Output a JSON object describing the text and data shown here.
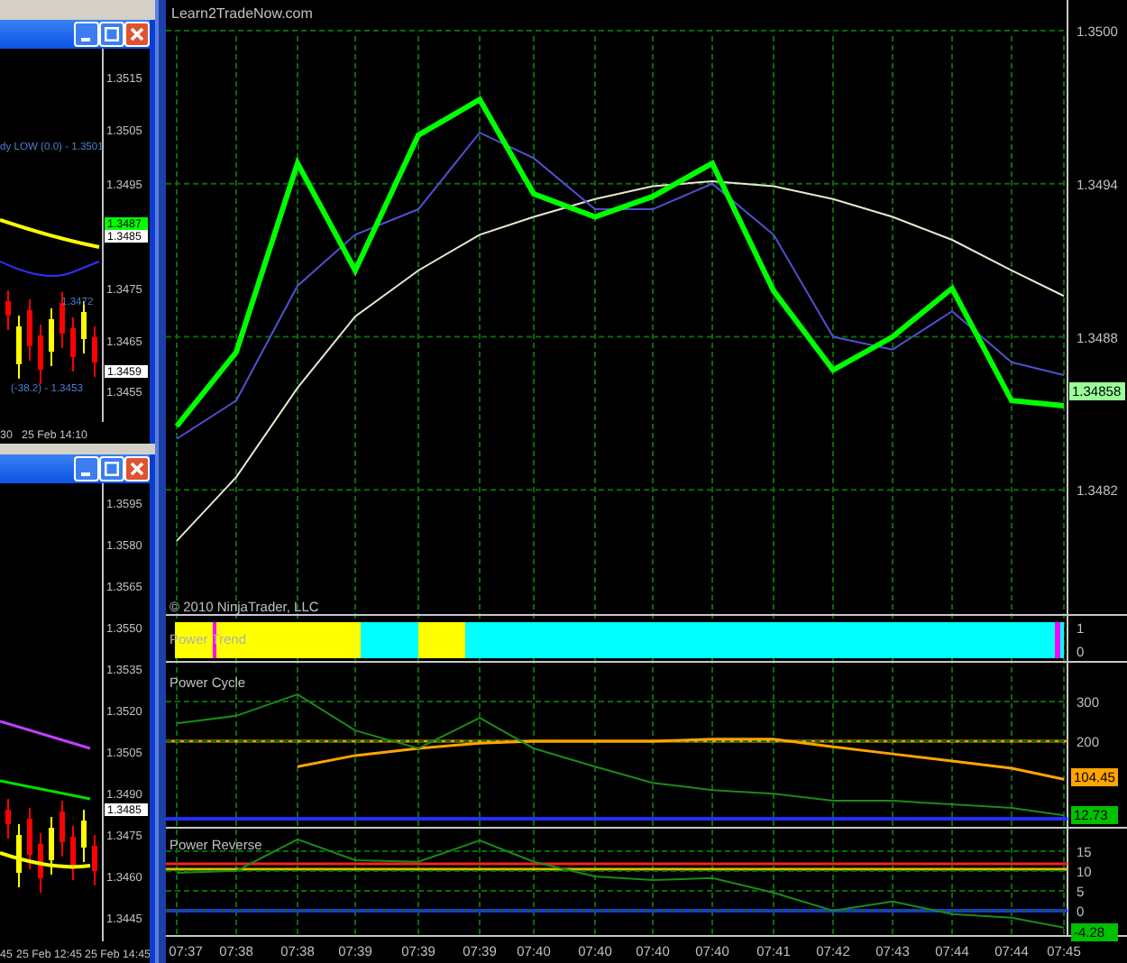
{
  "left_windows": [
    {
      "axis_labels": [
        "1.3515",
        "1.3505",
        "1.3495",
        "1.3475",
        "1.3465",
        "1.3455"
      ],
      "price_tags": [
        {
          "text": "1.3487",
          "color": "#00ff00"
        },
        {
          "text": "1.3485",
          "color": "#ffffff"
        },
        {
          "text": "1.3459",
          "color": "#ffffff"
        }
      ],
      "chart_texts": [
        "dy LOW (0.0) - 1.3501",
        "1.3472",
        "(-38.2) - 1.3453"
      ],
      "time_labels": [
        "30",
        "25 Feb 14:10"
      ]
    },
    {
      "axis_labels": [
        "1.3595",
        "1.3580",
        "1.3565",
        "1.3550",
        "1.3535",
        "1.3520",
        "1.3505",
        "1.3490",
        "1.3475",
        "1.3460",
        "1.3445"
      ],
      "price_tags": [
        {
          "text": "1.3485",
          "color": "#ffffff"
        }
      ],
      "time_labels": [
        "45",
        "25 Feb 12:45",
        "25 Feb 14:45"
      ]
    }
  ],
  "main_chart": {
    "title": "Learn2TradeNow.com",
    "copyright": "© 2010 NinjaTrader, LLC",
    "chart_data": {
      "type": "line",
      "ylim": [
        1.34771,
        1.35012
      ],
      "yticks": [
        {
          "value": 1.35,
          "label": "1.3500"
        },
        {
          "value": 1.3494,
          "label": "1.3494"
        },
        {
          "value": 1.3488,
          "label": "1.3488"
        },
        {
          "value": 1.3482,
          "label": "1.3482"
        }
      ],
      "series": [
        {
          "color": "#00ff00",
          "values": [
            1.34845,
            1.34874,
            1.34948,
            1.34906,
            1.34959,
            1.34973,
            1.34936,
            1.34927,
            1.34935,
            1.34948,
            1.34898,
            1.34867,
            1.3488,
            1.34899,
            1.34855,
            1.34853
          ]
        },
        {
          "color": "#5050d0",
          "values": [
            1.3484,
            1.34855,
            1.349,
            1.3492,
            1.3493,
            1.3496,
            1.3495,
            1.3493,
            1.3493,
            1.3494,
            1.3492,
            1.3488,
            1.34875,
            1.3489,
            1.3487,
            1.34865
          ]
        },
        {
          "color": "#e8e8d0",
          "values": [
            1.348,
            1.34825,
            1.3486,
            1.34888,
            1.34906,
            1.3492,
            1.34927,
            1.34934,
            1.34939,
            1.34941,
            1.34939,
            1.34934,
            1.34927,
            1.34918,
            1.34906,
            1.34896
          ]
        }
      ]
    },
    "last_price": {
      "text": "1.34858",
      "color": "#99ff99"
    },
    "panels": [
      {
        "kind": "trend",
        "title": "Power Trend",
        "axis": [
          "1",
          "0"
        ],
        "segments": [
          {
            "color": "#ffff00"
          },
          {
            "color": "#ff00ff"
          },
          {
            "color": "#ffff00"
          },
          {
            "color": "#00ffff"
          },
          {
            "color": "#ffff00"
          },
          {
            "color": "#00ffff"
          },
          {
            "color": "#ff00ff"
          },
          {
            "color": "#00ffff"
          }
        ]
      },
      {
        "kind": "cycle",
        "title": "Power Cycle",
        "chart_data": {
          "type": "line",
          "ylim": [
            -18,
            400
          ],
          "yticks": [
            {
              "value": 300,
              "label": "300"
            },
            {
              "value": 200,
              "label": "200"
            }
          ],
          "series": [
            {
              "color": "#1a8a1a",
              "values": [
                245,
                264,
                318,
                227,
                182,
                259,
                182,
                136,
                95,
                77,
                68,
                50,
                50,
                41,
                32,
                13
              ]
            },
            {
              "color": "#ffa500",
              "values": [
                null,
                null,
                136,
                164,
                182,
                195,
                200,
                200,
                200,
                205,
                205,
                186,
                168,
                150,
                132,
                104
              ]
            }
          ]
        },
        "tags": [
          {
            "text": "104.45",
            "color": "#ffa500"
          },
          {
            "text": "12.73",
            "color": "#00c000"
          }
        ]
      },
      {
        "kind": "reverse",
        "title": "Power Reverse",
        "chart_data": {
          "type": "line",
          "ylim": [
            -6.4,
            20.9
          ],
          "yticks": [
            {
              "value": 15,
              "label": "15"
            },
            {
              "value": 10,
              "label": "10"
            },
            {
              "value": 5,
              "label": "5"
            },
            {
              "value": 0,
              "label": "0"
            }
          ],
          "series": [
            {
              "color": "#1a8a1a",
              "values": [
                9.5,
                10,
                18,
                12.7,
                12.3,
                17.7,
                12.3,
                8.6,
                7.7,
                8.2,
                4.5,
                0,
                2.3,
                -0.9,
                -1.8,
                -4.3
              ]
            }
          ]
        },
        "tags": [
          {
            "text": "-4.28",
            "color": "#00c000"
          }
        ]
      }
    ],
    "time_axis": [
      "07:37",
      "07:38",
      "07:38",
      "07:39",
      "07:39",
      "07:39",
      "07:40",
      "07:40",
      "07:40",
      "07:40",
      "07:41",
      "07:42",
      "07:43",
      "07:44",
      "07:44",
      "07:45"
    ]
  }
}
